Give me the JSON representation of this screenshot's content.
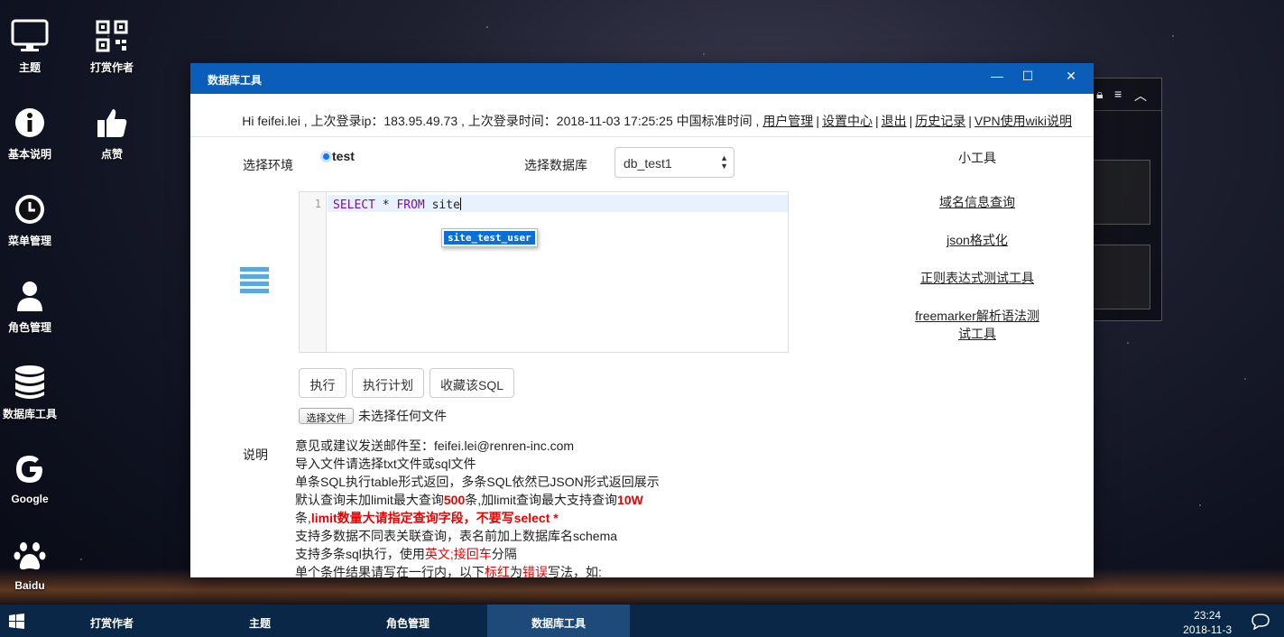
{
  "desktop": {
    "icons": [
      {
        "label": "主题",
        "icon": "monitor-icon"
      },
      {
        "label": "打赏作者",
        "icon": "qrcode-icon"
      },
      {
        "label": "基本说明",
        "icon": "info-icon"
      },
      {
        "label": "点赞",
        "icon": "thumbs-up-icon"
      },
      {
        "label": "菜单管理",
        "icon": "clock-icon"
      },
      {
        "label": "角色管理",
        "icon": "user-icon"
      },
      {
        "label": "数据库工具",
        "icon": "database-icon"
      },
      {
        "label": "Google",
        "icon": "google-icon"
      },
      {
        "label": "Baidu",
        "icon": "paw-icon"
      }
    ]
  },
  "window": {
    "title": "数据库工具",
    "controls": {
      "minimize": "—",
      "maximize": "☐",
      "close": "✕"
    }
  },
  "info": {
    "greeting": "Hi feifei.lei , 上次登录ip：183.95.49.73 , 上次登录时间：2018-11-03 17:25:25 中国标准时间 ,",
    "links": [
      "用户管理",
      "设置中心",
      "退出",
      "历史记录",
      "VPN使用wiki说明"
    ],
    "separator": "|"
  },
  "form": {
    "env_label": "选择环境",
    "env_option": "test",
    "db_label": "选择数据库",
    "db_selected": "db_test1"
  },
  "editor": {
    "line_number": "1",
    "kw1": "SELECT",
    "star": " * ",
    "kw2": "FROM",
    "rest": " site",
    "autocomplete": "site_test_user"
  },
  "buttons": {
    "execute": "执行",
    "plan": "执行计划",
    "save_sql": "收藏该SQL",
    "choose_file": "选择文件",
    "no_file": "未选择任何文件"
  },
  "notes": {
    "label": "说明",
    "line1": "意见或建议发送邮件至：feifei.lei@renren-inc.com",
    "line2": "导入文件请选择txt文件或sql文件",
    "line3": "单条SQL执行table形式返回，多条SQL依然已JSON形式返回展示",
    "line4a": "默认查询未加limit最大查询",
    "line4b": "500",
    "line4c": "条,加limit查询最大支持查询",
    "line4d": "10W",
    "line5a": "条,",
    "line5b": "limit数量大请指定查询字段，不要写select *",
    "line6": "支持多数据不同表关联查询，表名前加上数据库名schema",
    "line7a": "支持多条sql执行，使用",
    "line7b": "英文;接回车",
    "line7c": "分隔",
    "line8a": "单个条件结果请写在一行内，以下",
    "line8b": "标红",
    "line8c": "为",
    "line8d": "错误",
    "line8e": "写法，如:"
  },
  "tools": {
    "title": "小工具",
    "items": [
      "域名信息查询",
      "json格式化",
      "正则表达式测试工具",
      "freemarker解析语法测",
      "试工具"
    ]
  },
  "taskbar": {
    "items": [
      "打赏作者",
      "主题",
      "角色管理",
      "数据库工具"
    ],
    "active": "数据库工具",
    "time": "23:24",
    "date": "2018-11-3"
  }
}
